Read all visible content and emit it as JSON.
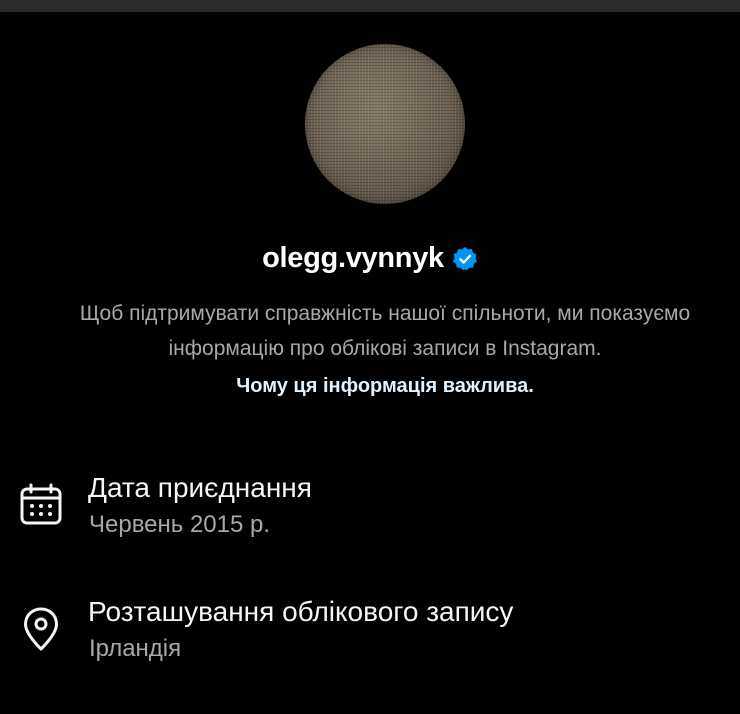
{
  "profile": {
    "username": "olegg.vynnyk",
    "verified": true,
    "avatar_icon": "profile-photo"
  },
  "notice": {
    "text": "Щоб підтримувати справжність нашої спільноти, ми показуємо інформацію про облікові записи в Instagram.",
    "link": "Чому ця інформація важлива."
  },
  "details": {
    "join_date": {
      "icon": "calendar-icon",
      "title": "Дата приєднання",
      "value": "Червень 2015 р."
    },
    "location": {
      "icon": "location-pin-icon",
      "title": "Розташування облікового запису",
      "value": "Ірландія"
    }
  },
  "colors": {
    "background": "#000000",
    "verified_badge": "#0095f6",
    "link": "#e0f1ff",
    "secondary_text": "#a8a8a8"
  }
}
